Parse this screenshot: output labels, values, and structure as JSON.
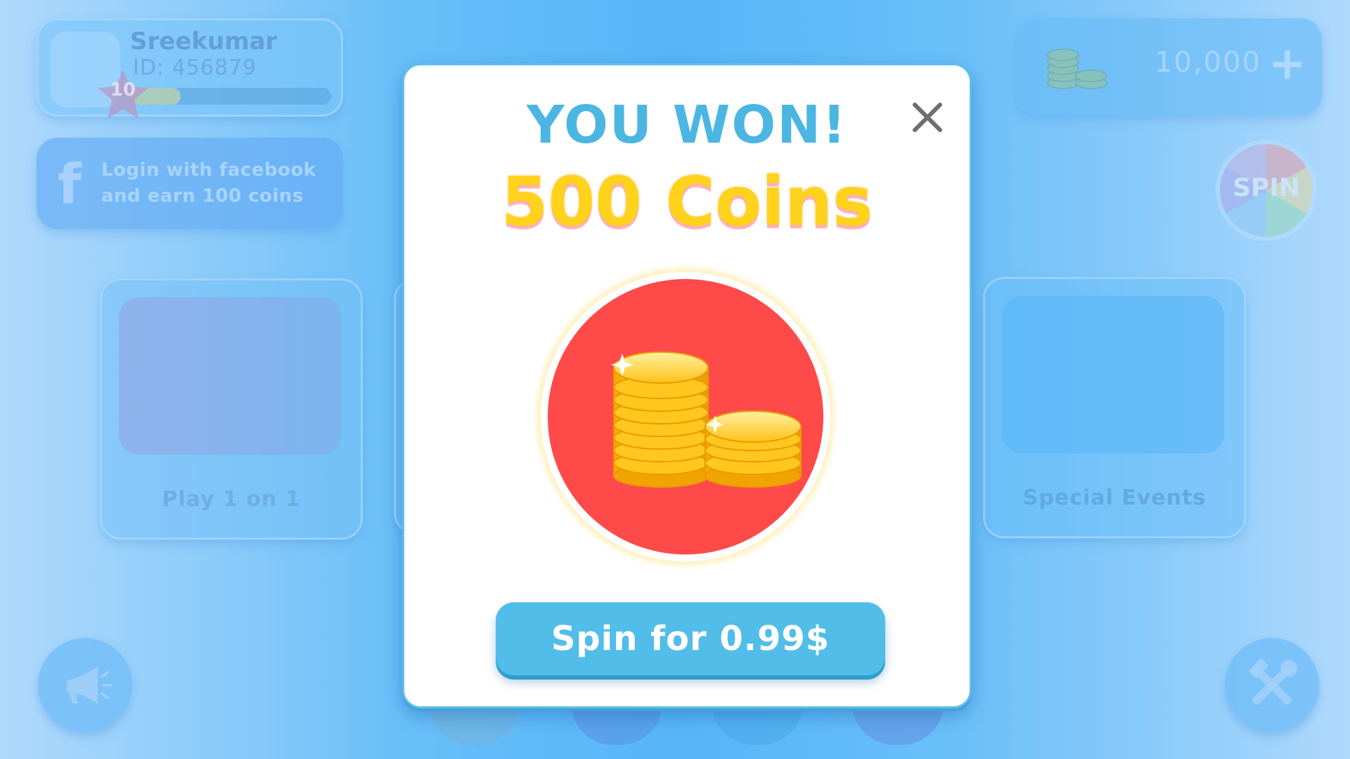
{
  "profile": {
    "username": "Sreekumar",
    "user_id": "ID: 456879",
    "level": "10",
    "xp_progress": 0.25
  },
  "facebook": {
    "icon": "facebook-icon",
    "line1": "Login with facebook",
    "line2": "and earn 100 coins"
  },
  "wallet": {
    "icon": "coin-stack-icon",
    "balance": "10,000",
    "add_icon": "plus-icon"
  },
  "spin_wheel": {
    "label": "SPIN"
  },
  "game_modes": [
    {
      "label": "Play 1 on 1"
    },
    {
      "label": "Special Events"
    }
  ],
  "bottom_bar": {
    "left_icon": "megaphone-icon",
    "right_icon": "settings-tools-icon"
  },
  "modal": {
    "title": "YOU WON!",
    "amount": "500 Coins",
    "prize_icon": "gold-coins-icon",
    "close_icon": "close-icon",
    "button_label": "Spin for 0.99$"
  },
  "colors": {
    "title_blue": "#4cb6e2",
    "amount_yellow": "#ffd21c",
    "prize_red": "#ff4a4a",
    "button_blue": "#52bde8"
  }
}
